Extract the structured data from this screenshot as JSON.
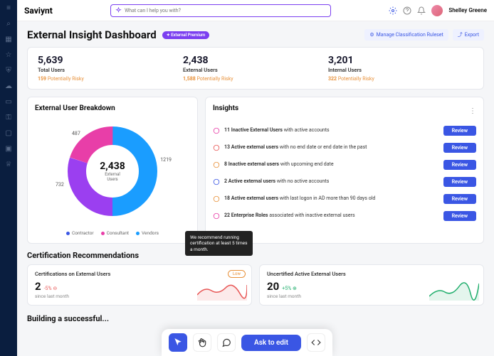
{
  "logo": "Saviynt",
  "search": {
    "placeholder": "What can I help you with?"
  },
  "user": {
    "name": "Shelley Greene"
  },
  "page": {
    "title": "External Insight Dashboard",
    "premium_badge": "✦ External Premium",
    "manage_btn": "Manage Classification Ruleset",
    "export_btn": "Export"
  },
  "stats": [
    {
      "value": "5,639",
      "label": "Total Users",
      "risky_count": "159",
      "risky_label": "Potentially Risky"
    },
    {
      "value": "2,438",
      "label": "External Users",
      "risky_count": "1,588",
      "risky_label": "Potentially Risky"
    },
    {
      "value": "3,201",
      "label": "Internal Users",
      "risky_count": "322",
      "risky_label": "Potentially Risky"
    }
  ],
  "breakdown": {
    "title": "External User Breakdown",
    "center_value": "2,438",
    "center_label": "External\nUsers",
    "labels": {
      "a": "487",
      "b": "732",
      "c": "1219"
    },
    "legend": [
      {
        "label": "Contractor",
        "color": "#3a56e4"
      },
      {
        "label": "Consultant",
        "color": "#e83ea8"
      },
      {
        "label": "Vendors",
        "color": "#1a9dff"
      }
    ]
  },
  "chart_data": {
    "type": "pie",
    "title": "External User Breakdown",
    "series": [
      {
        "name": "Contractor",
        "value": 487,
        "color": "#3a56e4"
      },
      {
        "name": "Consultant",
        "value": 732,
        "color": "#e83ea8"
      },
      {
        "name": "Vendors",
        "value": 1219,
        "color": "#1a9dff"
      }
    ],
    "total": 2438
  },
  "insights": {
    "title": "Insights",
    "review_label": "Review",
    "items": [
      {
        "icon": "user-x",
        "color": "#e83ea8",
        "bold": "11 Inactive External Users",
        "rest": " with active accounts"
      },
      {
        "icon": "calendar",
        "color": "#e85655",
        "bold": "13 Active external users",
        "rest": " with no end date or end date in the past"
      },
      {
        "icon": "bell",
        "color": "#e8913a",
        "bold": "8 Inactive external users",
        "rest": " with upcoming end date"
      },
      {
        "icon": "user-check",
        "color": "#3a56e4",
        "bold": "2 Active external users",
        "rest": " with no active accounts"
      },
      {
        "icon": "clock",
        "color": "#e8913a",
        "bold": "18 Active external users",
        "rest": " with last logon in AD more than 90 days old"
      },
      {
        "icon": "shield",
        "color": "#e83ea8",
        "bold": "22 Enterprise Roles",
        "rest": " associated with inactive external users"
      }
    ]
  },
  "cert": {
    "section_title": "Certification Recommendations",
    "tooltip": "We recommend running certification at least 5 times a month.",
    "cards": [
      {
        "title": "Certifications on External Users",
        "badge": "Low",
        "value": "2",
        "delta": "-5%",
        "delta_icon": "⊖",
        "sub": "since last month",
        "color": "#e85655"
      },
      {
        "title": "Uncertified Active External Users",
        "value": "20",
        "delta": "+5%",
        "delta_icon": "⊕",
        "sub": "since last month",
        "color": "#1fae6c"
      }
    ]
  },
  "building_title": "Building a successful...",
  "toolbar": {
    "ask_edit": "Ask to edit"
  }
}
